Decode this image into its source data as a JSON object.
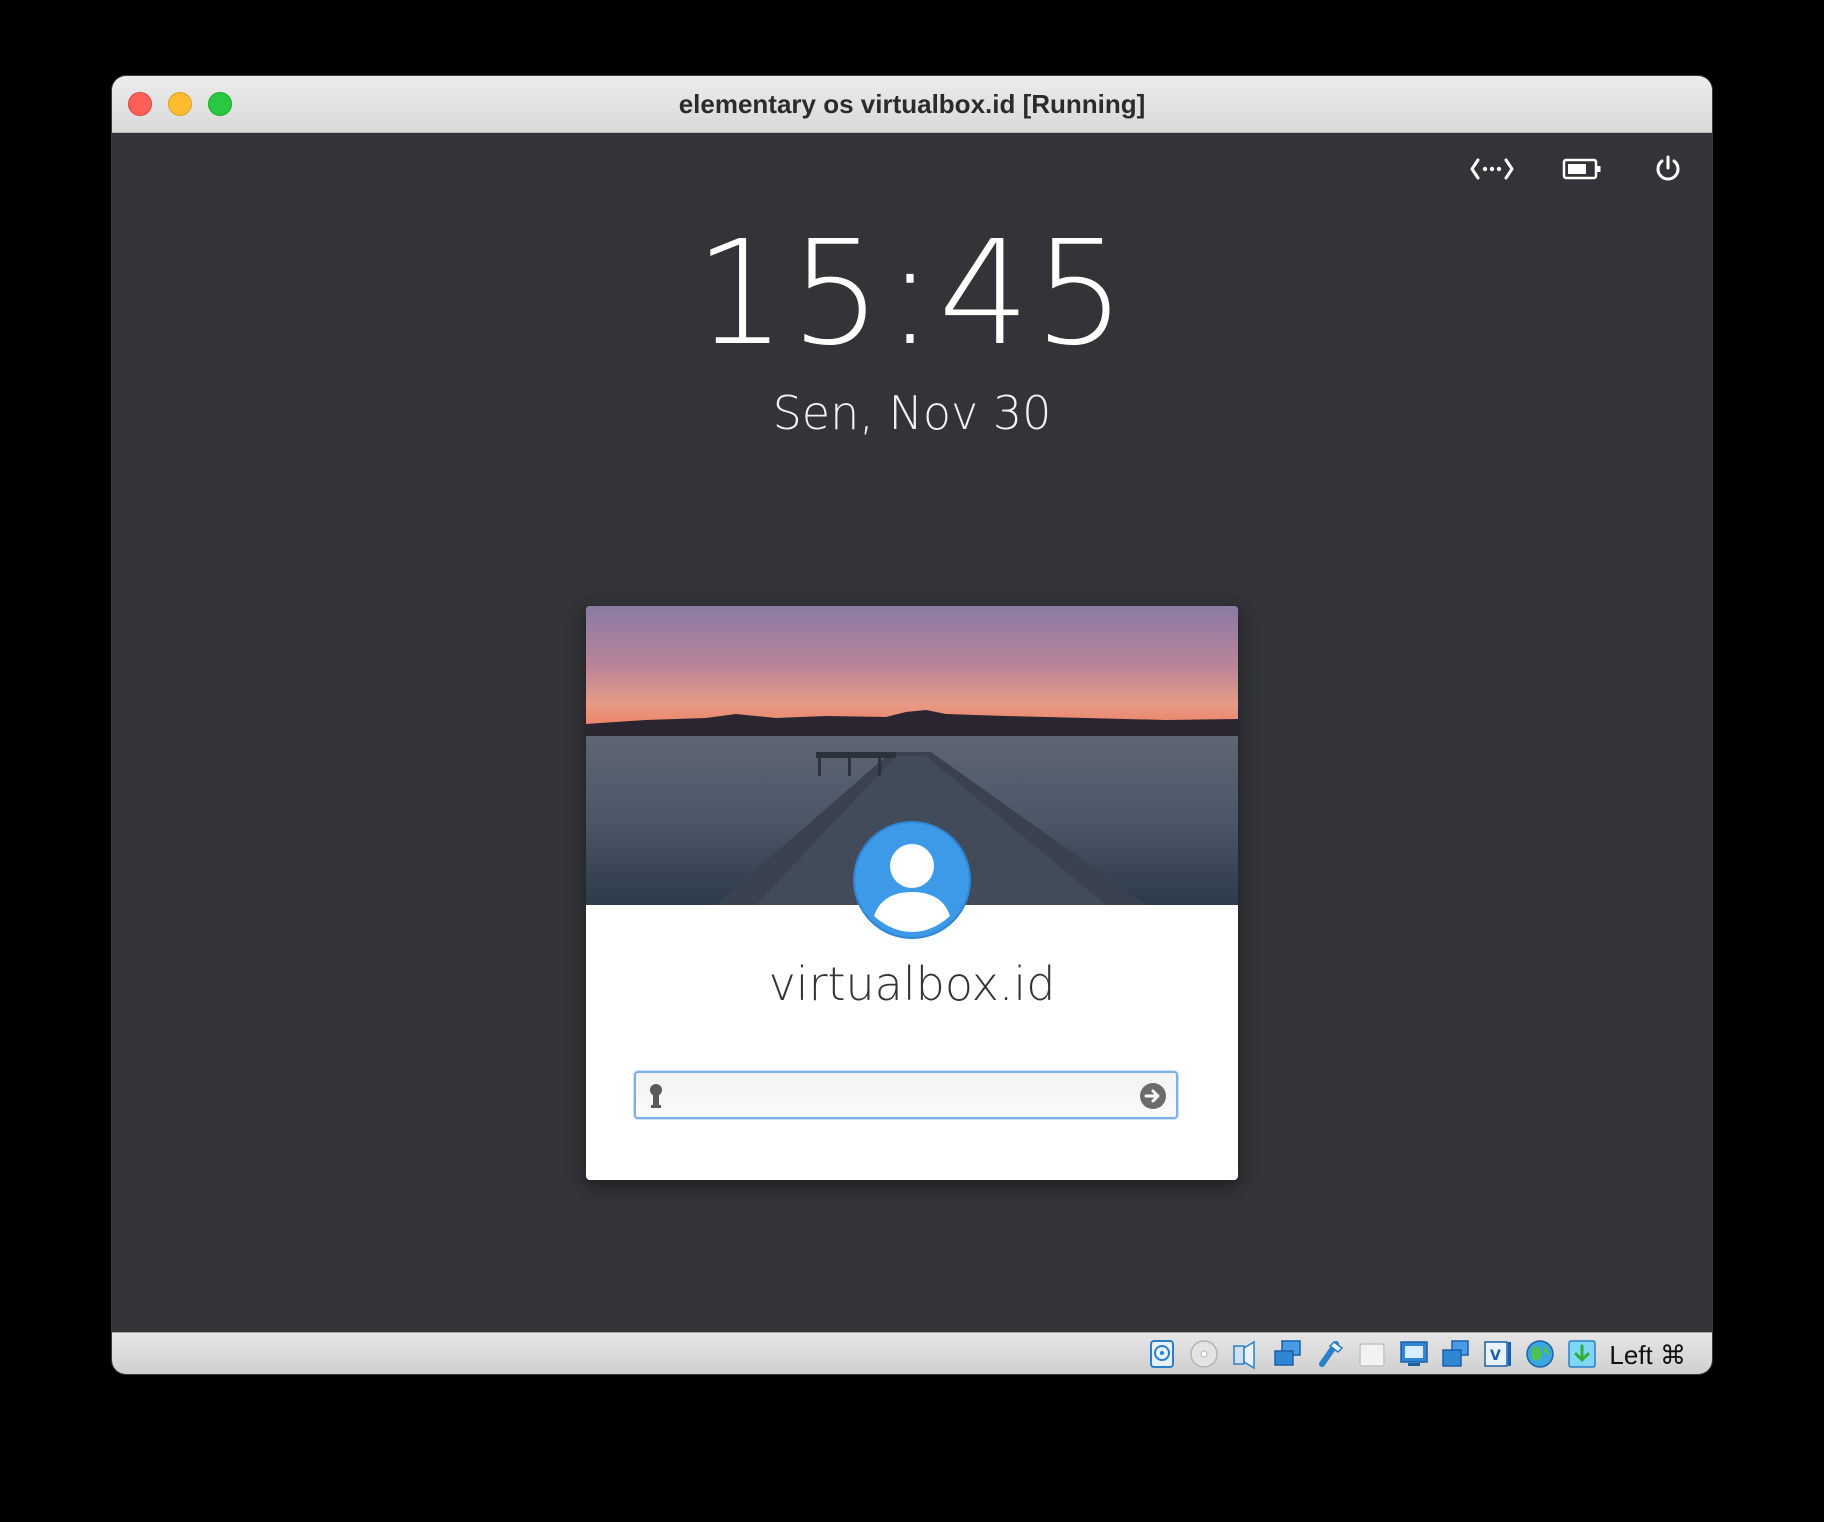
{
  "window": {
    "title": "elementary os virtualbox.id [Running]"
  },
  "tray": {
    "network_icon": "network-wired-icon",
    "battery_icon": "battery-icon",
    "power_icon": "power-icon"
  },
  "lockscreen": {
    "time": "15:45",
    "date": "Sen, Nov 30"
  },
  "login": {
    "username": "virtualbox.id",
    "password_placeholder": "",
    "avatar_icon": "user-avatar-icon",
    "key_icon": "key-icon",
    "submit_icon": "arrow-right-icon"
  },
  "statusbar": {
    "host_key": "Left ⌘",
    "icons": [
      "hard-disk-icon",
      "optical-drive-icon",
      "audio-icon",
      "network-icon",
      "usb-icon",
      "shared-folders-icon",
      "display-icon",
      "video-capture-icon",
      "vrde-icon",
      "guest-additions-icon",
      "mouse-integration-icon"
    ]
  },
  "colors": {
    "screen_bg": "#323438",
    "avatar_blue": "#3d9ae8",
    "input_focus": "#7db0e8"
  }
}
